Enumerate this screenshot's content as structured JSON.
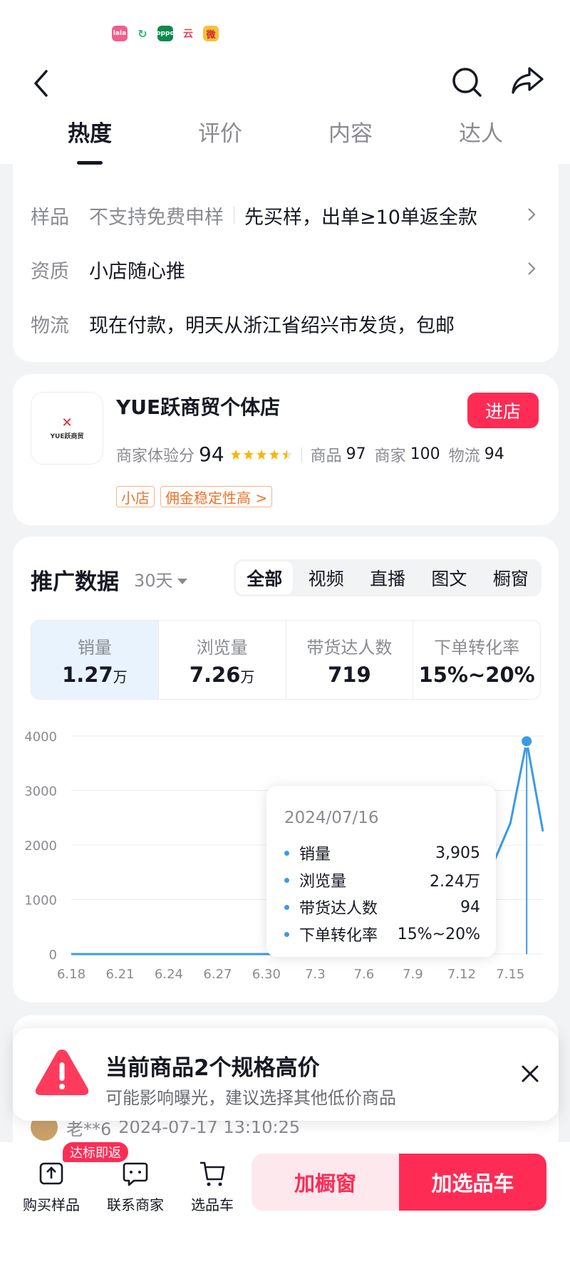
{
  "status_bar": {
    "icons": [
      "lala-app-icon",
      "refresh-app-icon",
      "oppo-app-icon",
      "yun-app-icon",
      "weibo-app-icon"
    ],
    "icon_labels": [
      "lala",
      "↻",
      "oppo",
      "云",
      "微"
    ]
  },
  "header": {
    "tabs": [
      "热度",
      "评价",
      "内容",
      "达人"
    ],
    "active_tab": "热度"
  },
  "info": {
    "rows": [
      {
        "key": "样品",
        "sub": "不支持免费申样",
        "value": "先买样，出单≥10单返全款"
      },
      {
        "key": "资质",
        "sub": "",
        "value": "小店随心推"
      },
      {
        "key": "物流",
        "sub": "",
        "value": "现在付款，明天从浙江省绍兴市发货，包邮"
      }
    ]
  },
  "shop": {
    "logo_text": "YUE跃商贸",
    "name": "YUE跃商贸个体店",
    "enter_label": "进店",
    "score_label": "商家体验分",
    "score": "94",
    "rating_stars": 4.5,
    "goods_label": "商品",
    "goods_score": "97",
    "merchant_label": "商家",
    "merchant_score": "100",
    "logistics_label": "物流",
    "logistics_score": "94",
    "tags": [
      "小店",
      "佣金稳定性高 >"
    ]
  },
  "promo": {
    "title": "推广数据",
    "period": "30天",
    "segments": [
      "全部",
      "视频",
      "直播",
      "图文",
      "橱窗"
    ],
    "active_segment": "全部",
    "metrics": [
      {
        "label": "销量",
        "value": "1.27",
        "unit": "万"
      },
      {
        "label": "浏览量",
        "value": "7.26",
        "unit": "万"
      },
      {
        "label": "带货达人数",
        "value": "719",
        "unit": ""
      },
      {
        "label": "下单转化率",
        "value": "15%~20%",
        "unit": ""
      }
    ],
    "tooltip": {
      "date": "2024/07/16",
      "rows": [
        {
          "name": "销量",
          "value": "3,905"
        },
        {
          "name": "浏览量",
          "value": "2.24万"
        },
        {
          "name": "带货达人数",
          "value": "94"
        },
        {
          "name": "下单转化率",
          "value": "15%~20%"
        }
      ]
    }
  },
  "chart_data": {
    "type": "line",
    "title": "",
    "xlabel": "",
    "ylabel": "",
    "x_ticks": [
      "6.18",
      "6.21",
      "6.24",
      "6.27",
      "6.30",
      "7.3",
      "7.6",
      "7.9",
      "7.12",
      "7.15"
    ],
    "y_ticks": [
      "0",
      "1000",
      "2000",
      "3000",
      "4000"
    ],
    "ylim": [
      0,
      4000
    ],
    "grid": true,
    "series_color": "#3b9ae6",
    "series": [
      {
        "x": [
          "6.18",
          "6.19",
          "6.20",
          "6.21",
          "6.22",
          "6.23",
          "6.24",
          "6.25",
          "6.26",
          "6.27",
          "6.28",
          "6.29",
          "6.30",
          "7.1",
          "7.2",
          "7.3",
          "7.4",
          "7.5",
          "7.6",
          "7.7",
          "7.8",
          "7.9",
          "7.10",
          "7.11",
          "7.12",
          "7.13",
          "7.14",
          "7.15",
          "7.16",
          "7.17"
        ],
        "values": [
          0,
          0,
          0,
          0,
          0,
          0,
          0,
          0,
          0,
          0,
          0,
          0,
          0,
          0,
          0,
          0,
          0,
          0,
          0,
          0,
          0,
          0,
          0,
          0,
          1900,
          1850,
          1700,
          2400,
          3905,
          2250
        ]
      }
    ],
    "highlight_index": 28
  },
  "next": {
    "comment_user": "老**6",
    "comment_time": "2024-07-17 13:10:25"
  },
  "warning": {
    "title": "当前商品2个规格高价",
    "subtitle": "可能影响曝光，建议选择其他低价商品"
  },
  "bottom": {
    "badge": "达标即返",
    "buy_sample": "购买样品",
    "contact": "联系商家",
    "cart": "选品车",
    "add_window": "加橱窗",
    "add_cart": "加选品车"
  }
}
